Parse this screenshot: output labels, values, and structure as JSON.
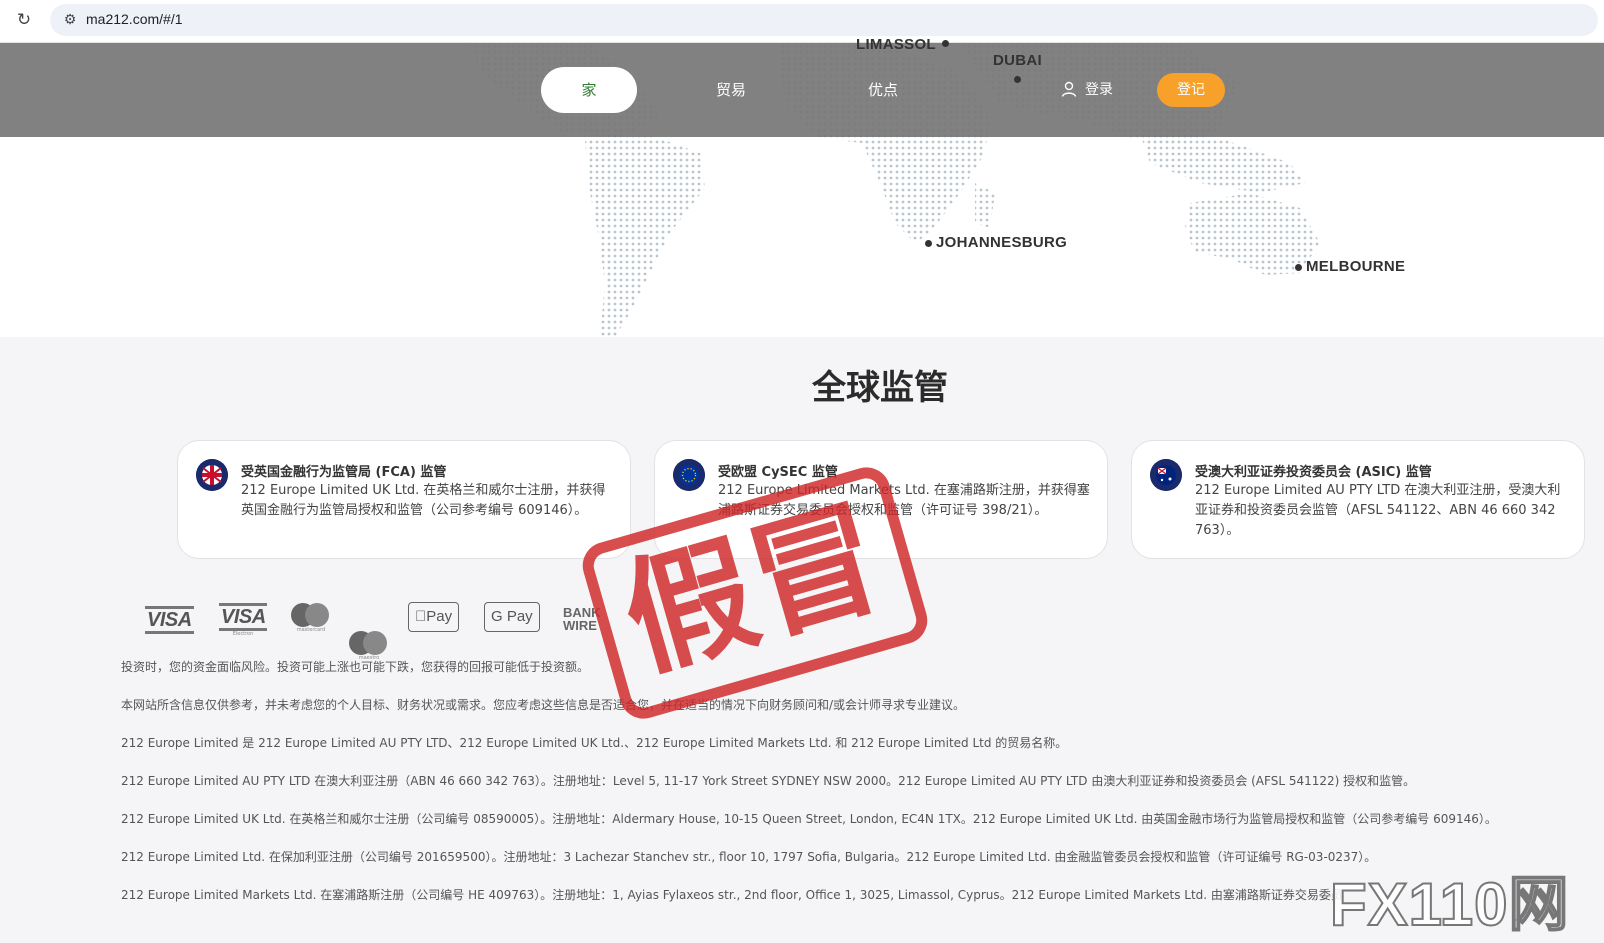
{
  "browser": {
    "url": "ma212.com/#/1"
  },
  "nav": {
    "home": "家",
    "trade": "贸易",
    "advantages": "优点",
    "login": "登录",
    "register": "登记"
  },
  "map": {
    "cities": [
      "LIMASSOL",
      "DUBAI",
      "JOHANNESBURG",
      "MELBOURNE"
    ]
  },
  "regulation": {
    "title": "全球监管",
    "cards": [
      {
        "title": "受英国金融行为监管局 (FCA) 监管",
        "body": "212 Europe Limited UK Ltd. 在英格兰和威尔士注册，并获得英国金融行为监管局授权和监管（公司参考编号 609146）。",
        "flag": "uk-flag-icon"
      },
      {
        "title": "受欧盟 CySEC 监管",
        "body": "212 Europe Limited Markets Ltd. 在塞浦路斯注册，并获得塞浦路斯证券交易委员会授权和监管（许可证号 398/21）。",
        "flag": "eu-flag-icon"
      },
      {
        "title": "受澳大利亚证券投资委员会 (ASIC) 监管",
        "body": "212 Europe Limited AU PTY LTD 在澳大利亚注册，受澳大利亚证券和投资委员会监管（AFSL 541122、ABN 46 660 342 763）。",
        "flag": "au-flag-icon"
      }
    ]
  },
  "payments": {
    "visa1": "VISA",
    "visa2": "VISA",
    "visa2_sub": "Electron",
    "mastercard": "mastercard",
    "maestro": "maestro",
    "applepay": "Pay",
    "gpay": "G Pay",
    "bank1": "BANK",
    "bank2": "WIRE"
  },
  "disclaimers": [
    "投资时，您的资金面临风险。投资可能上涨也可能下跌，您获得的回报可能低于投资额。",
    "本网站所含信息仅供参考，并未考虑您的个人目标、财务状况或需求。您应考虑这些信息是否适合您，并在适当的情况下向财务顾问和/或会计师寻求专业建议。",
    "212 Europe Limited 是 212 Europe Limited AU PTY LTD、212 Europe Limited UK Ltd.、212 Europe Limited Markets Ltd. 和 212 Europe Limited Ltd 的贸易名称。",
    "212 Europe Limited AU PTY LTD 在澳大利亚注册（ABN 46 660 342 763）。注册地址：Level 5, 11-17 York Street SYDNEY NSW 2000。212 Europe Limited AU PTY LTD 由澳大利亚证券和投资委员会 (AFSL 541122) 授权和监管。",
    "212 Europe Limited UK Ltd. 在英格兰和威尔士注册（公司编号 08590005）。注册地址：Aldermary House, 10-15 Queen Street, London, EC4N 1TX。212 Europe Limited UK Ltd. 由英国金融市场行为监管局授权和监管（公司参考编号 609146）。",
    "212 Europe Limited Ltd. 在保加利亚注册（公司编号 201659500）。注册地址：3 Lachezar Stanchev str., floor 10, 1797 Sofia, Bulgaria。212 Europe Limited Ltd. 由金融监管委员会授权和监管（许可证编号 RG-03-0237）。",
    "212 Europe Limited Markets Ltd. 在塞浦路斯注册（公司编号 HE 409763）。注册地址：1, Ayias Fylaxeos str., 2nd floor, Office 1, 3025, Limassol, Cyprus。212 Europe Limited Markets Ltd. 由塞浦路斯证券交易委员会授权和监管（许可证号 398/21）。"
  ],
  "stamp": {
    "text": "假冒",
    "color": "#d02626"
  },
  "watermark": "FX110网"
}
